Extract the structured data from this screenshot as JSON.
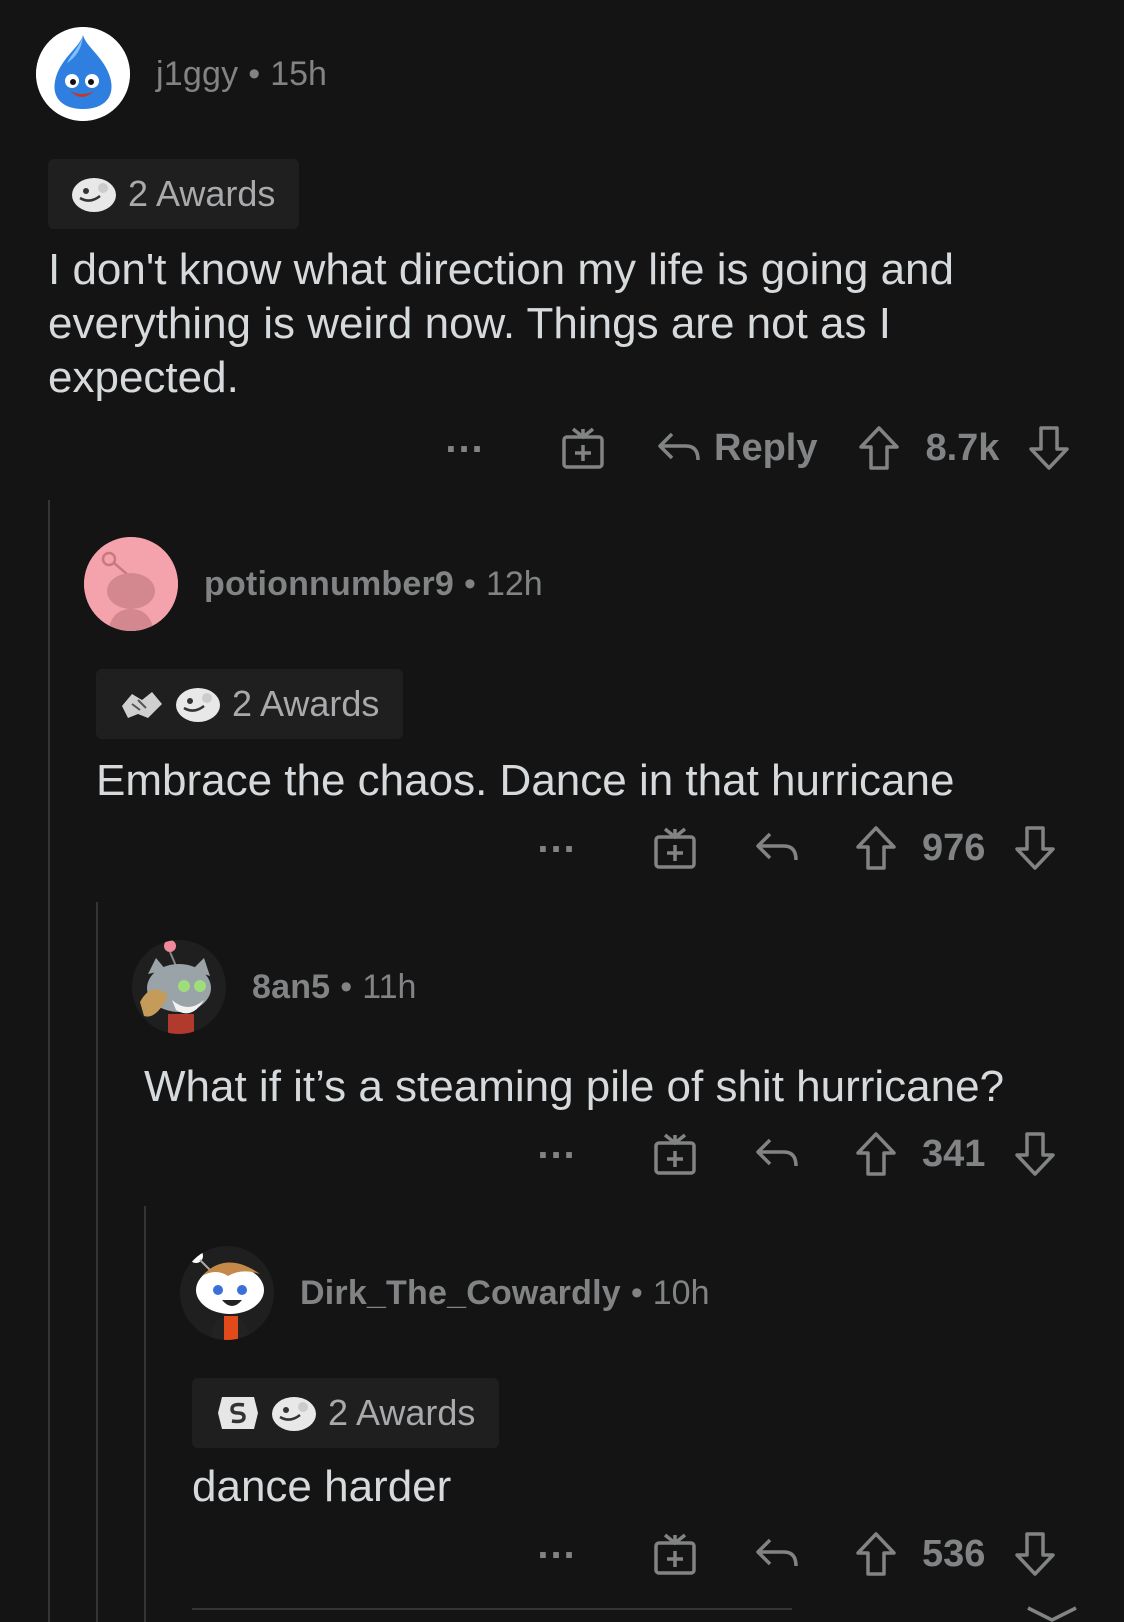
{
  "comments": [
    {
      "username": "j1ggy",
      "time": "15h",
      "awards_label": "2 Awards",
      "body": "I don't know what direction my life is going and everything is weird now. Things are not as I expected.",
      "reply_label": "Reply",
      "score": "8.7k",
      "more": "..."
    },
    {
      "username": "potionnumber9",
      "time": "12h",
      "awards_label": "2 Awards",
      "body": "Embrace the chaos. Dance in that hurricane",
      "score": "976",
      "more": "..."
    },
    {
      "username": "8an5",
      "time": "11h",
      "body": "What if it’s a steaming pile of shit hurricane?",
      "score": "341",
      "more": "..."
    },
    {
      "username": "Dirk_The_Cowardly",
      "time": "10h",
      "awards_label": "2 Awards",
      "body": "dance harder",
      "score": "536",
      "more": "..."
    }
  ],
  "separator": "•",
  "icons": {
    "award_helpful": "wholesome-seal-icon",
    "award_hands": "handshake-icon",
    "award_silver": "silver-award-icon",
    "give_award": "gift-icon",
    "reply": "reply-arrow-icon",
    "upvote": "upvote-arrow-icon",
    "downvote": "downvote-arrow-icon"
  },
  "colors": {
    "background": "#141414",
    "text": "#d7dadc",
    "muted": "#818384",
    "award_pill": "#1f1f20",
    "thread_line": "#343536"
  }
}
